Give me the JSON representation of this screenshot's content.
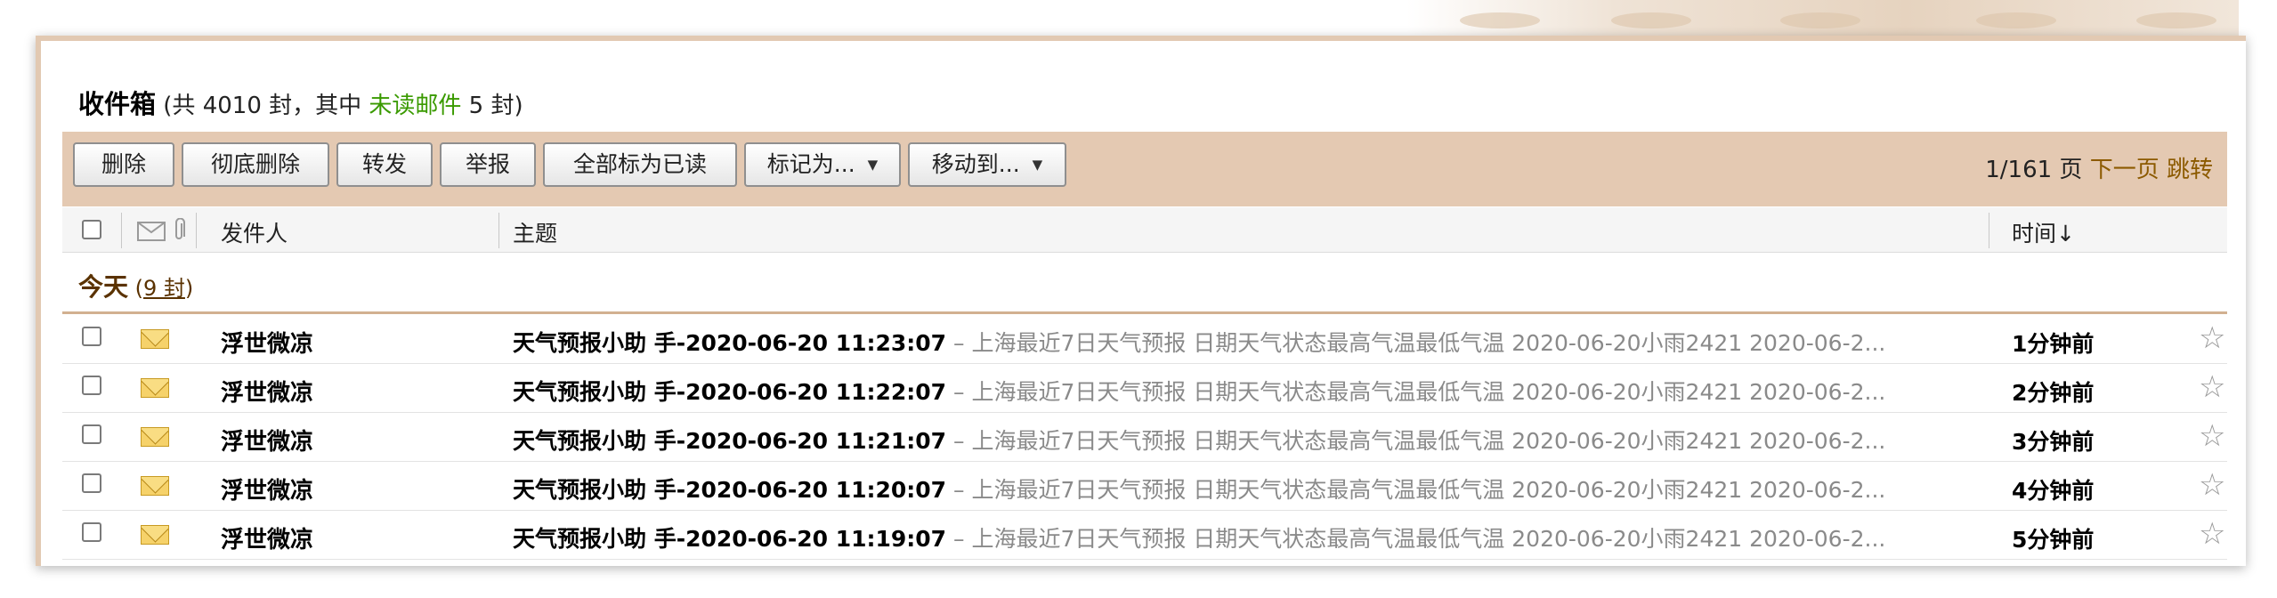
{
  "inbox": {
    "title": "收件箱",
    "count_prefix": " (共 4010 封，其中 ",
    "unread_label": "未读邮件",
    "count_suffix": " 5 封)"
  },
  "toolbar": {
    "delete": "删除",
    "perm_delete": "彻底删除",
    "forward": "转发",
    "report": "举报",
    "mark_all_read": "全部标为已读",
    "mark_as": "标记为...",
    "move_to": "移动到...",
    "dropdown_glyph": "▼"
  },
  "pager": {
    "page_info": "1/161 页",
    "next": "下一页",
    "jump": "跳转"
  },
  "columns": {
    "sender": "发件人",
    "subject": "主题",
    "time": "时间↓"
  },
  "group": {
    "label": "今天",
    "open_paren": " (",
    "count": "9 封",
    "close_paren": ")"
  },
  "icons": {
    "header_envelope": "envelope-icon",
    "header_attachment": "paperclip-icon",
    "row_envelope": "envelope-icon",
    "row_star": "star-icon"
  },
  "colors": {
    "toolbar_bg": "#e4c9b2",
    "unread_green": "#3a9a00",
    "link_brown": "#8c5a00"
  },
  "star_glyph": "☆",
  "emails": [
    {
      "sender": "浮世微凉",
      "subject": "天气预报小助 手-2020-06-20 11:23:07",
      "preview": " – 上海最近7日天气预报 日期天气状态最高气温最低气温 2020-06-20小雨2421 2020-06-2...",
      "time": "1分钟前"
    },
    {
      "sender": "浮世微凉",
      "subject": "天气预报小助 手-2020-06-20 11:22:07",
      "preview": " – 上海最近7日天气预报 日期天气状态最高气温最低气温 2020-06-20小雨2421 2020-06-2...",
      "time": "2分钟前"
    },
    {
      "sender": "浮世微凉",
      "subject": "天气预报小助 手-2020-06-20 11:21:07",
      "preview": " – 上海最近7日天气预报 日期天气状态最高气温最低气温 2020-06-20小雨2421 2020-06-2...",
      "time": "3分钟前"
    },
    {
      "sender": "浮世微凉",
      "subject": "天气预报小助 手-2020-06-20 11:20:07",
      "preview": " – 上海最近7日天气预报 日期天气状态最高气温最低气温 2020-06-20小雨2421 2020-06-2...",
      "time": "4分钟前"
    },
    {
      "sender": "浮世微凉",
      "subject": "天气预报小助 手-2020-06-20 11:19:07",
      "preview": " – 上海最近7日天气预报 日期天气状态最高气温最低气温 2020-06-20小雨2421 2020-06-2...",
      "time": "5分钟前"
    }
  ]
}
